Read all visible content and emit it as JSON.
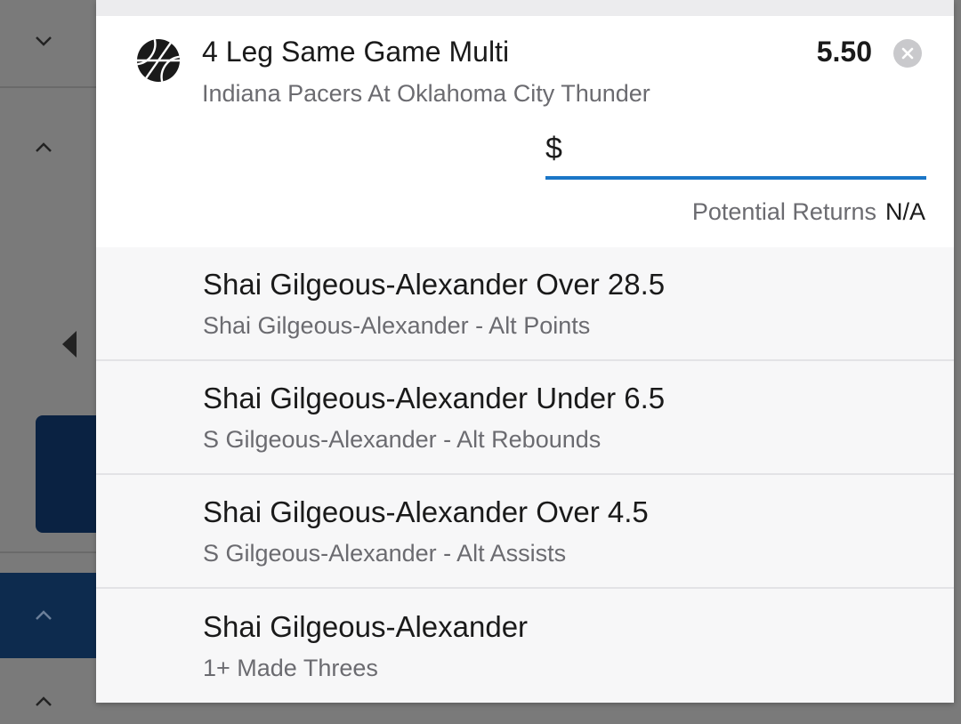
{
  "bet": {
    "title": "4 Leg Same Game Multi",
    "odds": "5.50",
    "event": "Indiana Pacers At Oklahoma City Thunder",
    "stake_currency": "$",
    "stake_value": "",
    "returns_label": "Potential Returns",
    "returns_value": "N/A",
    "icon": "basketball-icon"
  },
  "legs": [
    {
      "title": "Shai Gilgeous-Alexander Over 28.5",
      "market": "Shai Gilgeous-Alexander - Alt Points"
    },
    {
      "title": "Shai Gilgeous-Alexander Under 6.5",
      "market": "S Gilgeous-Alexander - Alt Rebounds"
    },
    {
      "title": "Shai Gilgeous-Alexander Over 4.5",
      "market": "S Gilgeous-Alexander - Alt Assists"
    },
    {
      "title": "Shai Gilgeous-Alexander",
      "market": "1+ Made Threes"
    }
  ],
  "colors": {
    "accent": "#1a76c7",
    "overlay": "#7a7a7a",
    "navy": "#0d2b4e"
  }
}
